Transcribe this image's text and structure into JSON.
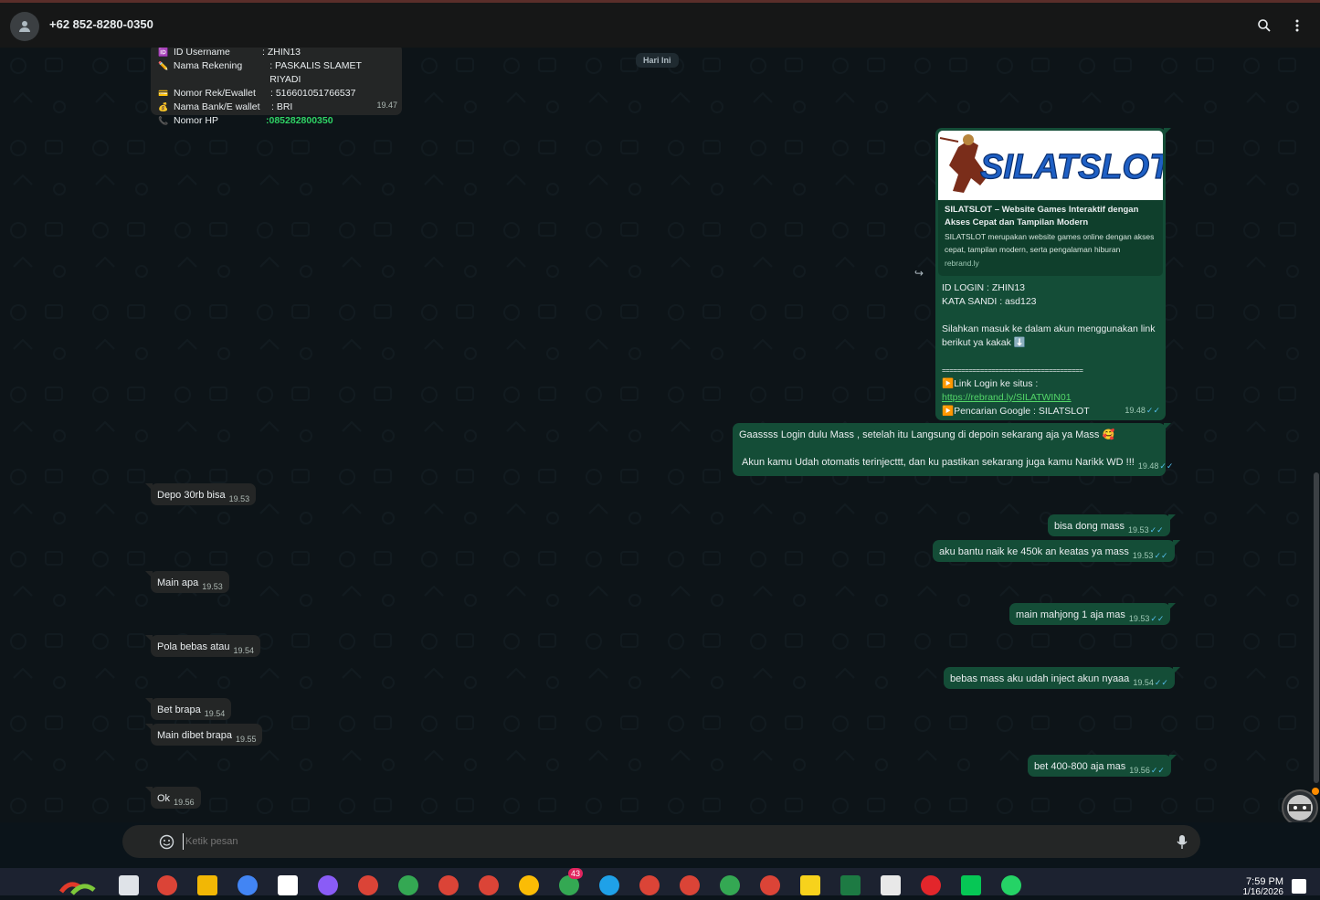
{
  "header": {
    "contact_name": "+62 852-8280-0350",
    "icons": [
      "person-icon",
      "search-icon",
      "more-vertical-icon"
    ]
  },
  "chat": {
    "date_chip": "Hari Ini",
    "first_message": {
      "lines": [
        {
          "icon": "🆔",
          "label": "ID Username",
          "value": ": ZHIN13"
        },
        {
          "icon": "✏️",
          "label": "Nama Rekening",
          "value": ":  PASKALIS SLAMET RIYADI"
        },
        {
          "icon": "💳",
          "label": "Nomor Rek/Ewallet",
          "value": ": 516601051766537"
        },
        {
          "icon": "💰",
          "label": "Nama Bank/E wallet",
          "value": ": BRI"
        },
        {
          "icon": "📞",
          "label": "Nomor HP",
          "value": ":085282800350"
        }
      ],
      "time": "19.47"
    },
    "promo_message": {
      "image_text": "SILATSLOT",
      "preview_title": "SILATSLOT – Website Games Interaktif dengan Akses Cepat dan Tampilan Modern",
      "preview_desc": "SILATSLOT merupakan website games online dengan akses cepat, tampilan modern, serta pengalaman hiburan",
      "preview_domain": "rebrand.ly",
      "body_lines": [
        "ID LOGIN : ZHIN13",
        "KATA SANDI : asd123",
        "",
        "Silahkan masuk ke dalam akun menggunakan link berikut ya kakak ⬇️",
        "",
        "=====================================",
        "▶️Link Login ke situs  :"
      ],
      "link": "https://rebrand.ly/SILATWIN01",
      "last_line": "▶️Pencarian Google : SILATSLOT",
      "time": "19.48"
    },
    "messages": [
      {
        "dir": "out",
        "text": "Gaassss Login dulu Mass  , setelah itu Langsung di depoin sekarang aja ya Mass 🥰",
        "text2": "Akun kamu Udah otomatis terinjecttt, dan ku pastikan sekarang juga kamu Narikk WD !!!",
        "time": "19.48"
      },
      {
        "dir": "in",
        "text": "Depo 30rb bisa",
        "time": "19.53"
      },
      {
        "dir": "out",
        "text": "bisa dong mass",
        "time": "19.53"
      },
      {
        "dir": "out",
        "text": "aku bantu naik ke 450k an keatas ya mass",
        "time": "19.53"
      },
      {
        "dir": "in",
        "text": "Main apa",
        "time": "19.53"
      },
      {
        "dir": "out",
        "text": "main mahjong 1 aja mas",
        "time": "19.53"
      },
      {
        "dir": "in",
        "text": "Pola bebas atau",
        "time": "19.54"
      },
      {
        "dir": "out",
        "text": "bebas mass aku udah inject akun nyaaa",
        "time": "19.54"
      },
      {
        "dir": "in",
        "text": "Bet brapa",
        "time": "19.54"
      },
      {
        "dir": "in",
        "text": "Main dibet brapa",
        "time": "19.55"
      },
      {
        "dir": "out",
        "text": "bet 400-800 aja mas",
        "time": "19.56"
      },
      {
        "dir": "in",
        "text": "Ok",
        "time": "19.56"
      }
    ]
  },
  "composer": {
    "placeholder": "Ketik pesan"
  },
  "taskbar": {
    "time": "7:59 PM",
    "date": "1/16/2026",
    "badge": "43"
  },
  "colors": {
    "outgoing": "#144d37",
    "incoming": "#242626",
    "background": "#0d1418",
    "accent_green": "#2fd465"
  }
}
